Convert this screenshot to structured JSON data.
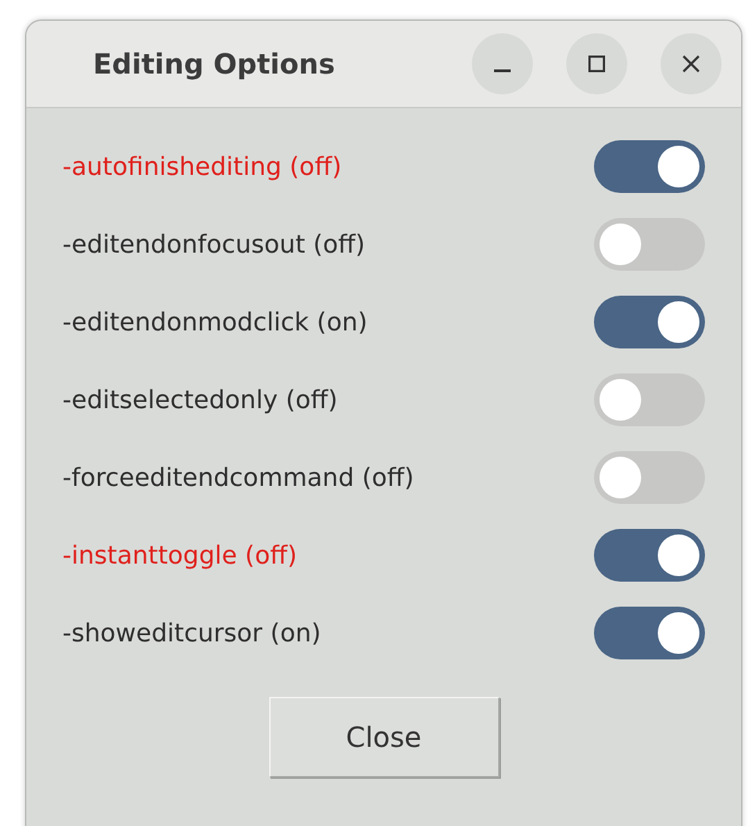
{
  "window": {
    "title": "Editing Options"
  },
  "options": [
    {
      "label": "-autofinishediting (off)",
      "highlighted": true,
      "on": true
    },
    {
      "label": "-editendonfocusout (off)",
      "highlighted": false,
      "on": false
    },
    {
      "label": "-editendonmodclick (on)",
      "highlighted": false,
      "on": true
    },
    {
      "label": "-editselectedonly (off)",
      "highlighted": false,
      "on": false
    },
    {
      "label": "-forceeditendcommand (off)",
      "highlighted": false,
      "on": false
    },
    {
      "label": "-instanttoggle (off)",
      "highlighted": true,
      "on": true
    },
    {
      "label": "-showeditcursor (on)",
      "highlighted": false,
      "on": true
    }
  ],
  "buttons": [
    "Close"
  ]
}
